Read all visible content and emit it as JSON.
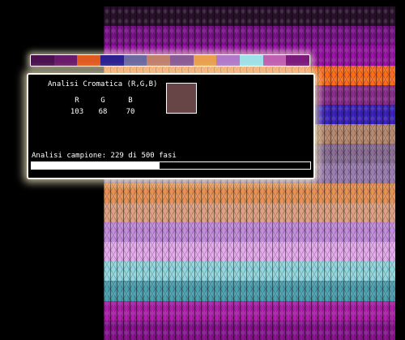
{
  "knit_bands": [
    {
      "color": "#2a0f2c"
    },
    {
      "color": "#7a0f8a"
    },
    {
      "color": "#9a10a8"
    },
    {
      "color": "#ff6a18"
    },
    {
      "color": "#8a2a8c"
    },
    {
      "color": "#3a20c0"
    },
    {
      "color": "#b8876c"
    },
    {
      "color": "#8a6c96"
    },
    {
      "color": "#9a7cb4"
    },
    {
      "color": "#e89050"
    },
    {
      "color": "#e0a080"
    },
    {
      "color": "#c48ae0"
    },
    {
      "color": "#e8a8f0"
    },
    {
      "color": "#8ed8e0"
    },
    {
      "color": "#4aa0b0"
    },
    {
      "color": "#b01cac"
    },
    {
      "color": "#8a1090"
    }
  ],
  "palette_colors": [
    "#4a1050",
    "#6a1a6a",
    "#e05a20",
    "#2a2090",
    "#6a6aa0",
    "#c0806c",
    "#8a5c96",
    "#e8a050",
    "#b07ac8",
    "#9ee0e8",
    "#c060b0",
    "#7a1a7a"
  ],
  "panel": {
    "title": "Analisi Cromatica (R,G,B)",
    "labels": {
      "r": "R",
      "g": "G",
      "b": "B"
    },
    "values": {
      "r": "103",
      "g": "68",
      "b": "70"
    },
    "swatch_color": "#674446",
    "status": "Analisi campione: 229 di 500 fasi",
    "progress": 0.458
  }
}
